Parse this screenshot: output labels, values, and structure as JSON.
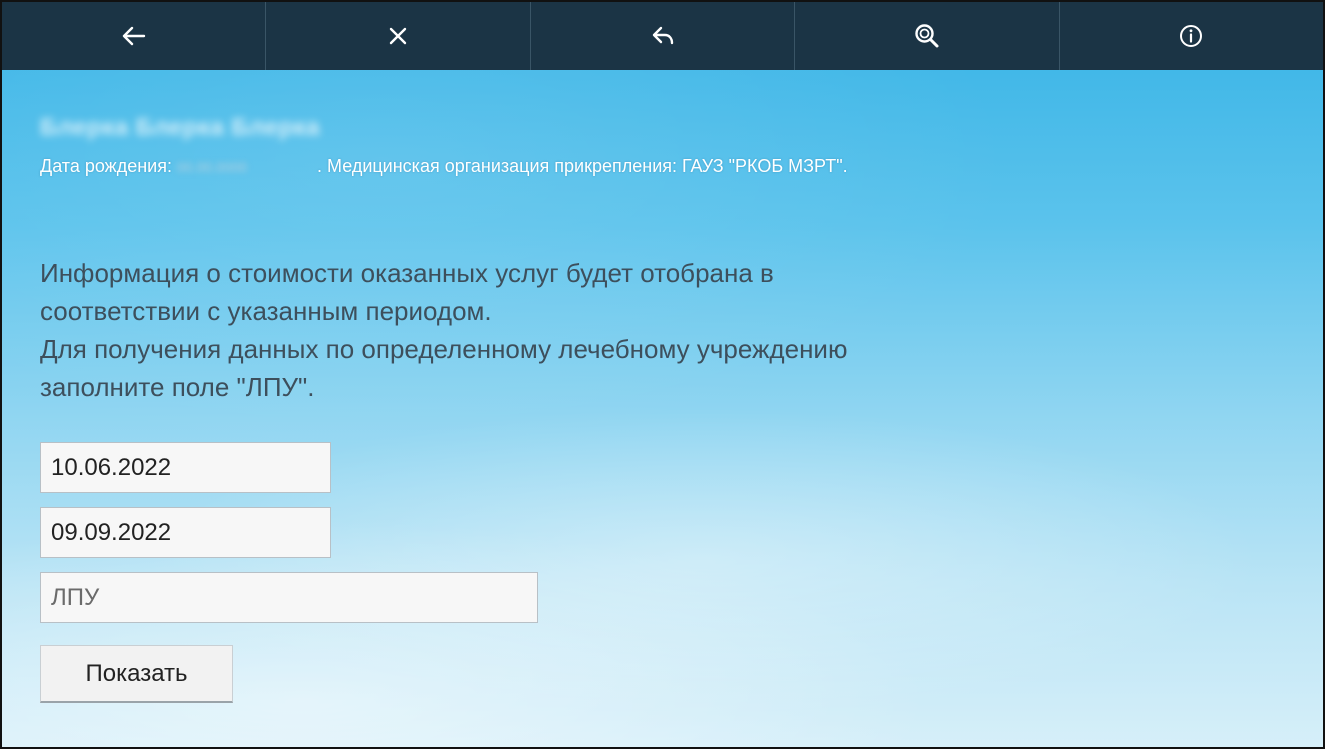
{
  "toolbar": {
    "buttons": [
      {
        "icon": "arrow-left-icon"
      },
      {
        "icon": "close-icon"
      },
      {
        "icon": "reply-icon"
      },
      {
        "icon": "search-icon"
      },
      {
        "icon": "info-icon"
      }
    ]
  },
  "patient": {
    "name": "Блерка Блерка Блерка",
    "dob_label": "Дата рождения:",
    "dob_value": "00.00.0000",
    "org_text": ". Медицинская организация прикрепления: ГАУЗ \"РКОБ МЗРТ\"."
  },
  "info": {
    "line1": "Информация о стоимости оказанных услуг будет отобрана в",
    "line2": "соответствии с указанным периодом.",
    "line3": "Для получения данных по определенному лечебному учреждению",
    "line4": "заполните поле \"ЛПУ\"."
  },
  "form": {
    "date_from": "10.06.2022",
    "date_to": "09.09.2022",
    "lpu_placeholder": "ЛПУ",
    "show_label": "Показать"
  },
  "colors": {
    "toolbar_bg": "#1b3445",
    "sky_top": "#37b3e6",
    "sky_bottom": "#d6eff9"
  }
}
